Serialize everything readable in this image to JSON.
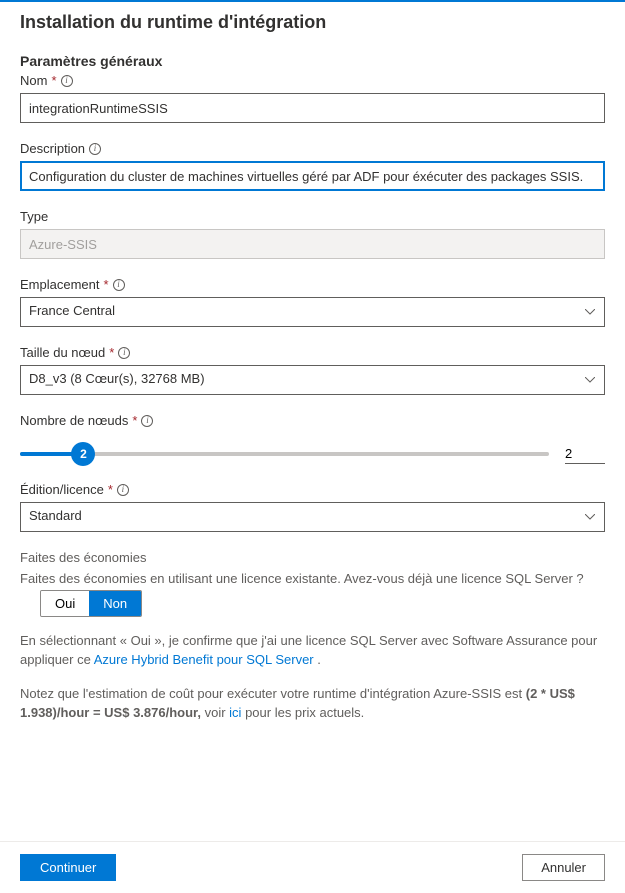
{
  "page_title": "Installation du runtime d'intégration",
  "section_title": "Paramètres généraux",
  "fields": {
    "name": {
      "label": "Nom",
      "value": "integrationRuntimeSSIS",
      "required": true
    },
    "description": {
      "label": "Description",
      "value": "Configuration du cluster de machines virtuelles géré par ADF pour éxécuter des packages SSIS.",
      "required": false
    },
    "type": {
      "label": "Type",
      "value": "Azure-SSIS",
      "required": false
    },
    "location": {
      "label": "Emplacement",
      "value": "France Central",
      "required": true
    },
    "node_size": {
      "label": "Taille du nœud",
      "value": "D8_v3 (8 Cœur(s), 32768 MB)",
      "required": true
    },
    "node_count": {
      "label": "Nombre de nœuds",
      "value": "2",
      "thumb": "2",
      "required": true
    },
    "edition": {
      "label": "Édition/licence",
      "value": "Standard",
      "required": true
    }
  },
  "savings": {
    "subtitle": "Faites des économies",
    "text_part1": "Faites des économies en utilisant une licence existante. Avez-vous déjà une licence SQL Server ?",
    "yes": "Oui",
    "no": "Non",
    "confirm_prefix": "En sélectionnant « Oui », je confirme que j'ai une licence SQL Server avec Software Assurance pour appliquer ce ",
    "confirm_link": "Azure Hybrid Benefit pour SQL Server",
    "confirm_suffix": " .",
    "cost_prefix": "Notez que l'estimation de coût pour exécuter votre runtime d'intégration Azure-SSIS est ",
    "cost_bold": "(2 * US$ 1.938)/hour = US$ 3.876/hour,",
    "cost_mid": " voir ",
    "cost_link": "ici",
    "cost_suffix": " pour les prix actuels."
  },
  "footer": {
    "continue": "Continuer",
    "cancel": "Annuler"
  }
}
